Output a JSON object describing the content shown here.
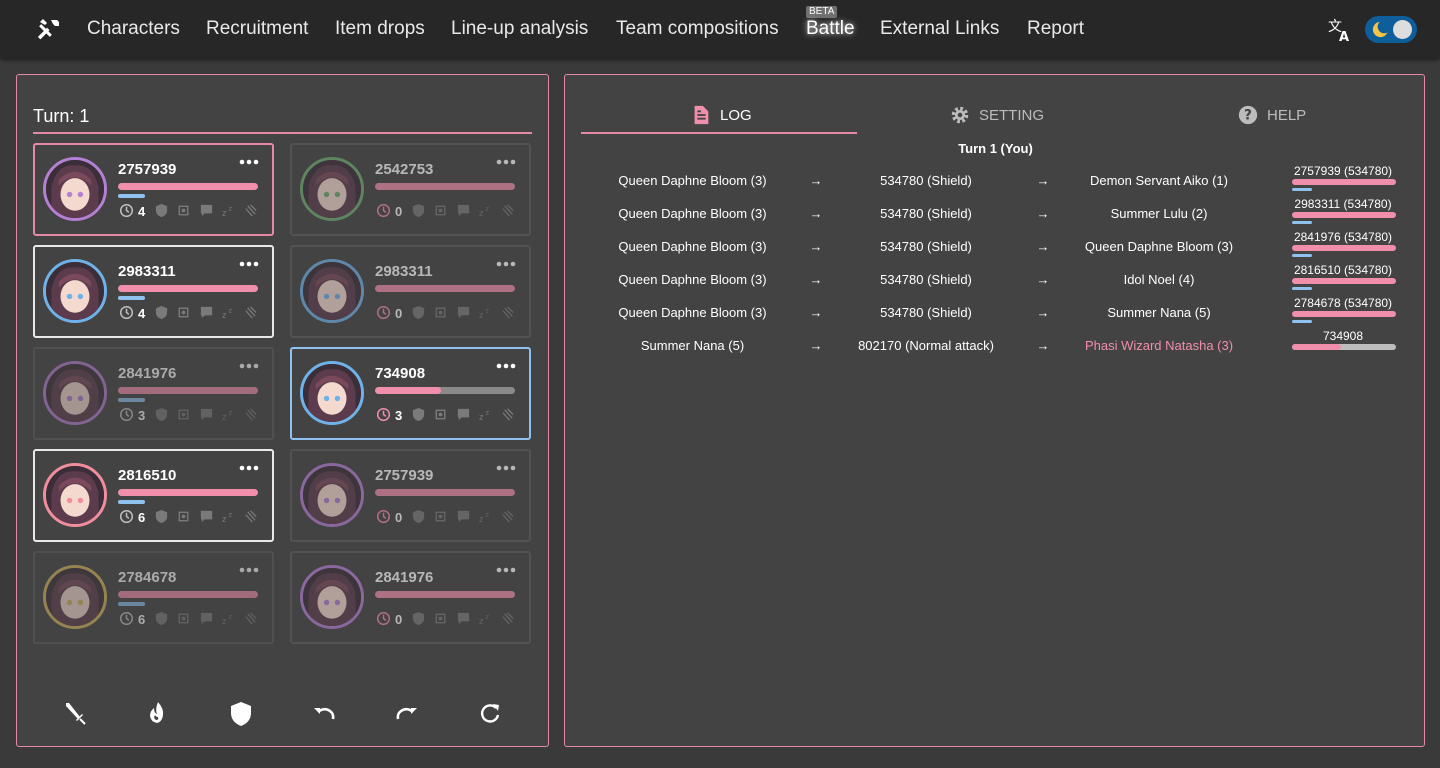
{
  "nav": {
    "items": [
      "Characters",
      "Recruitment",
      "Item drops",
      "Line-up analysis",
      "Team compositions",
      "Battle",
      "External Links",
      "Report"
    ],
    "beta_badge": "BETA"
  },
  "left": {
    "turn_label": "Turn: 1",
    "cards": [
      {
        "hp": "2757939",
        "hp_frac": 1.0,
        "turns": "4",
        "side": "ally",
        "state": "selected",
        "ring": "#b57fd4"
      },
      {
        "hp": "2542753",
        "hp_frac": 1.0,
        "turns": "0",
        "side": "enemy",
        "state": "dim",
        "ring": "#6fae72"
      },
      {
        "hp": "2983311",
        "hp_frac": 1.0,
        "turns": "4",
        "side": "ally",
        "state": "active",
        "ring": "#6fb2ea"
      },
      {
        "hp": "2983311",
        "hp_frac": 1.0,
        "turns": "0",
        "side": "enemy",
        "state": "dim",
        "ring": "#6fb2ea"
      },
      {
        "hp": "2841976",
        "hp_frac": 1.0,
        "turns": "3",
        "side": "ally",
        "state": "dim",
        "ring": "#b57fd4"
      },
      {
        "hp": "734908",
        "hp_frac": 0.47,
        "turns": "3",
        "side": "enemy",
        "state": "focused",
        "ring": "#6fb2ea"
      },
      {
        "hp": "2816510",
        "hp_frac": 1.0,
        "turns": "6",
        "side": "ally",
        "state": "active",
        "ring": "#f08e9e"
      },
      {
        "hp": "2757939",
        "hp_frac": 1.0,
        "turns": "0",
        "side": "enemy",
        "state": "dim",
        "ring": "#b57fd4"
      },
      {
        "hp": "2784678",
        "hp_frac": 1.0,
        "turns": "6",
        "side": "ally",
        "state": "dim",
        "ring": "#d9b85c"
      },
      {
        "hp": "2841976",
        "hp_frac": 1.0,
        "turns": "0",
        "side": "enemy",
        "state": "dim",
        "ring": "#b57fd4"
      }
    ],
    "actions": [
      "sword-icon",
      "fire-icon",
      "shield-icon",
      "undo-icon",
      "redo-icon",
      "reset-icon"
    ]
  },
  "right": {
    "tabs": [
      "LOG",
      "SETTING",
      "HELP"
    ],
    "log": {
      "turn_header": "Turn 1 (You)",
      "arrow": "→",
      "rows": [
        {
          "actor": "Queen Daphne Bloom (3)",
          "skill": "534780 (Shield)",
          "target": "Demon Servant Aiko (1)",
          "hp": "2757939 (534780)",
          "target_enemy": false
        },
        {
          "actor": "Queen Daphne Bloom (3)",
          "skill": "534780 (Shield)",
          "target": "Summer Lulu (2)",
          "hp": "2983311 (534780)",
          "target_enemy": false
        },
        {
          "actor": "Queen Daphne Bloom (3)",
          "skill": "534780 (Shield)",
          "target": "Queen Daphne Bloom (3)",
          "hp": "2841976 (534780)",
          "target_enemy": false
        },
        {
          "actor": "Queen Daphne Bloom (3)",
          "skill": "534780 (Shield)",
          "target": "Idol Noel (4)",
          "hp": "2816510 (534780)",
          "target_enemy": false
        },
        {
          "actor": "Queen Daphne Bloom (3)",
          "skill": "534780 (Shield)",
          "target": "Summer Nana (5)",
          "hp": "2784678 (534780)",
          "target_enemy": false
        },
        {
          "actor": "Summer Nana (5)",
          "skill": "802170 (Normal attack)",
          "target": "Phasi Wizard Natasha (3)",
          "hp": "734908",
          "target_enemy": true
        }
      ]
    }
  },
  "colors": {
    "accent": "#e58aa5",
    "hp_pink": "#f08eab",
    "shield_blue": "#8fc2ee",
    "panel_bg": "#434343"
  }
}
